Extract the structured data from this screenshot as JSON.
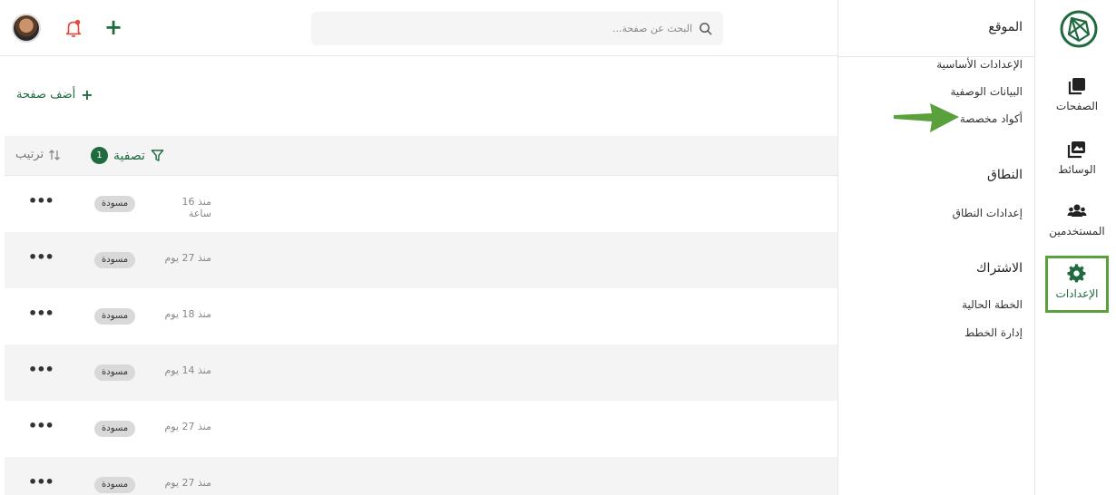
{
  "rail": {
    "items": [
      {
        "label": "الصفحات",
        "icon": "pages-icon"
      },
      {
        "label": "الوسائط",
        "icon": "media-icon"
      },
      {
        "label": "المستخدمين",
        "icon": "users-icon"
      },
      {
        "label": "الإعدادات",
        "icon": "gear-icon",
        "active": true
      }
    ]
  },
  "menu": {
    "site_heading": "الموقع",
    "site_links": [
      "الإعدادات الأساسية",
      "البيانات الوصفية",
      "أكواد مخصصة"
    ],
    "domain_heading": "النطاق",
    "domain_links": [
      "إعدادات النطاق"
    ],
    "subscription_heading": "الاشتراك",
    "subscription_links": [
      "الخطة الحالية",
      "إدارة الخطط"
    ]
  },
  "search": {
    "placeholder": "البحث عن صفحة..."
  },
  "toolbar": {
    "add_page": "أضف صفحة",
    "filter_label": "تصفية",
    "filter_count": "1",
    "sort_label": "ترتيب"
  },
  "pages": [
    {
      "time": "منذ 16 ساعة",
      "status": "مسودة"
    },
    {
      "time": "منذ 27 يوم",
      "status": "مسودة"
    },
    {
      "time": "منذ 18 يوم",
      "status": "مسودة"
    },
    {
      "time": "منذ 14 يوم",
      "status": "مسودة"
    },
    {
      "time": "منذ 27 يوم",
      "status": "مسودة"
    },
    {
      "time": "منذ 27 يوم",
      "status": "مسودة"
    }
  ],
  "colors": {
    "accent": "#1f6a3f",
    "highlight": "#5aa03c",
    "notification": "#e04b3c"
  }
}
